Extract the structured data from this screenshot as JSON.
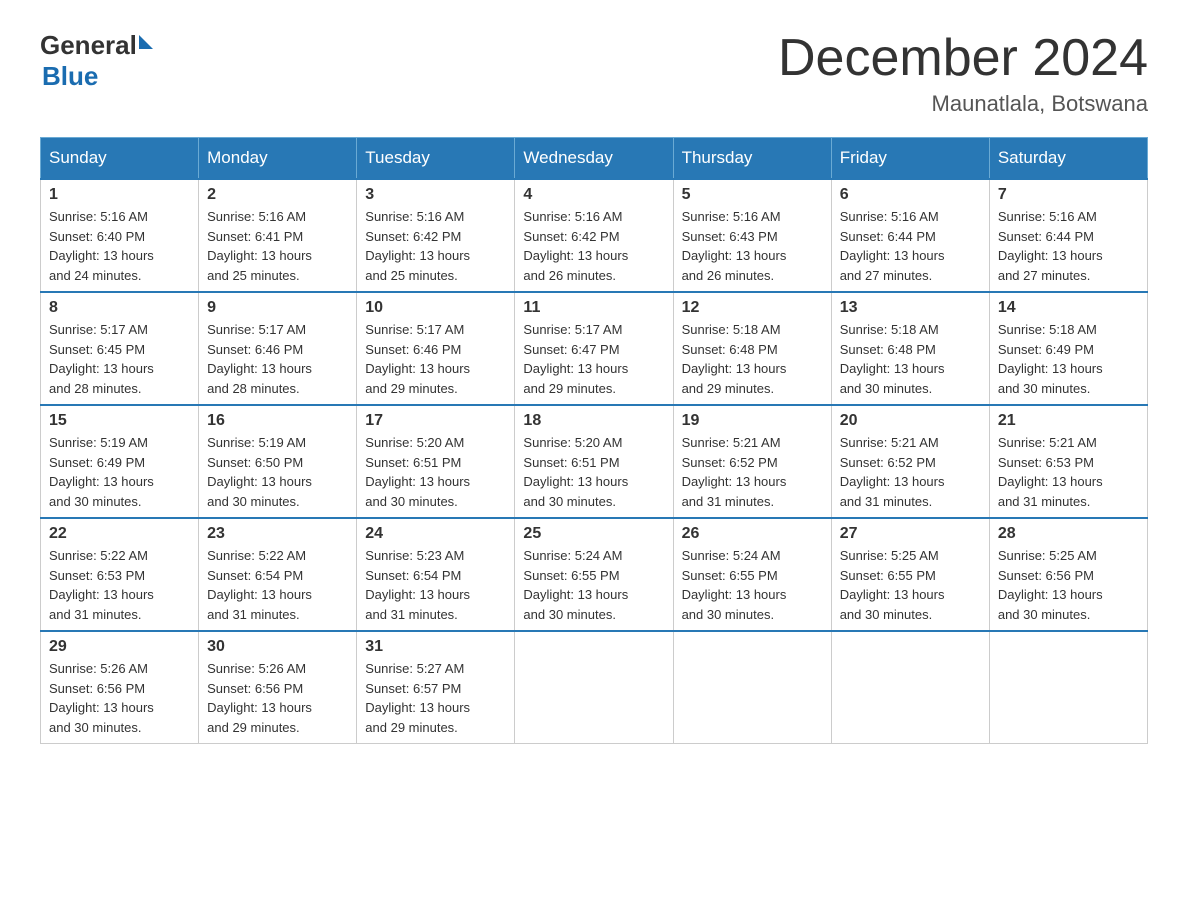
{
  "header": {
    "logo_general": "General",
    "logo_blue": "Blue",
    "month_title": "December 2024",
    "location": "Maunatlala, Botswana"
  },
  "days_of_week": [
    "Sunday",
    "Monday",
    "Tuesday",
    "Wednesday",
    "Thursday",
    "Friday",
    "Saturday"
  ],
  "weeks": [
    [
      {
        "day": "1",
        "info": "Sunrise: 5:16 AM\nSunset: 6:40 PM\nDaylight: 13 hours\nand 24 minutes."
      },
      {
        "day": "2",
        "info": "Sunrise: 5:16 AM\nSunset: 6:41 PM\nDaylight: 13 hours\nand 25 minutes."
      },
      {
        "day": "3",
        "info": "Sunrise: 5:16 AM\nSunset: 6:42 PM\nDaylight: 13 hours\nand 25 minutes."
      },
      {
        "day": "4",
        "info": "Sunrise: 5:16 AM\nSunset: 6:42 PM\nDaylight: 13 hours\nand 26 minutes."
      },
      {
        "day": "5",
        "info": "Sunrise: 5:16 AM\nSunset: 6:43 PM\nDaylight: 13 hours\nand 26 minutes."
      },
      {
        "day": "6",
        "info": "Sunrise: 5:16 AM\nSunset: 6:44 PM\nDaylight: 13 hours\nand 27 minutes."
      },
      {
        "day": "7",
        "info": "Sunrise: 5:16 AM\nSunset: 6:44 PM\nDaylight: 13 hours\nand 27 minutes."
      }
    ],
    [
      {
        "day": "8",
        "info": "Sunrise: 5:17 AM\nSunset: 6:45 PM\nDaylight: 13 hours\nand 28 minutes."
      },
      {
        "day": "9",
        "info": "Sunrise: 5:17 AM\nSunset: 6:46 PM\nDaylight: 13 hours\nand 28 minutes."
      },
      {
        "day": "10",
        "info": "Sunrise: 5:17 AM\nSunset: 6:46 PM\nDaylight: 13 hours\nand 29 minutes."
      },
      {
        "day": "11",
        "info": "Sunrise: 5:17 AM\nSunset: 6:47 PM\nDaylight: 13 hours\nand 29 minutes."
      },
      {
        "day": "12",
        "info": "Sunrise: 5:18 AM\nSunset: 6:48 PM\nDaylight: 13 hours\nand 29 minutes."
      },
      {
        "day": "13",
        "info": "Sunrise: 5:18 AM\nSunset: 6:48 PM\nDaylight: 13 hours\nand 30 minutes."
      },
      {
        "day": "14",
        "info": "Sunrise: 5:18 AM\nSunset: 6:49 PM\nDaylight: 13 hours\nand 30 minutes."
      }
    ],
    [
      {
        "day": "15",
        "info": "Sunrise: 5:19 AM\nSunset: 6:49 PM\nDaylight: 13 hours\nand 30 minutes."
      },
      {
        "day": "16",
        "info": "Sunrise: 5:19 AM\nSunset: 6:50 PM\nDaylight: 13 hours\nand 30 minutes."
      },
      {
        "day": "17",
        "info": "Sunrise: 5:20 AM\nSunset: 6:51 PM\nDaylight: 13 hours\nand 30 minutes."
      },
      {
        "day": "18",
        "info": "Sunrise: 5:20 AM\nSunset: 6:51 PM\nDaylight: 13 hours\nand 30 minutes."
      },
      {
        "day": "19",
        "info": "Sunrise: 5:21 AM\nSunset: 6:52 PM\nDaylight: 13 hours\nand 31 minutes."
      },
      {
        "day": "20",
        "info": "Sunrise: 5:21 AM\nSunset: 6:52 PM\nDaylight: 13 hours\nand 31 minutes."
      },
      {
        "day": "21",
        "info": "Sunrise: 5:21 AM\nSunset: 6:53 PM\nDaylight: 13 hours\nand 31 minutes."
      }
    ],
    [
      {
        "day": "22",
        "info": "Sunrise: 5:22 AM\nSunset: 6:53 PM\nDaylight: 13 hours\nand 31 minutes."
      },
      {
        "day": "23",
        "info": "Sunrise: 5:22 AM\nSunset: 6:54 PM\nDaylight: 13 hours\nand 31 minutes."
      },
      {
        "day": "24",
        "info": "Sunrise: 5:23 AM\nSunset: 6:54 PM\nDaylight: 13 hours\nand 31 minutes."
      },
      {
        "day": "25",
        "info": "Sunrise: 5:24 AM\nSunset: 6:55 PM\nDaylight: 13 hours\nand 30 minutes."
      },
      {
        "day": "26",
        "info": "Sunrise: 5:24 AM\nSunset: 6:55 PM\nDaylight: 13 hours\nand 30 minutes."
      },
      {
        "day": "27",
        "info": "Sunrise: 5:25 AM\nSunset: 6:55 PM\nDaylight: 13 hours\nand 30 minutes."
      },
      {
        "day": "28",
        "info": "Sunrise: 5:25 AM\nSunset: 6:56 PM\nDaylight: 13 hours\nand 30 minutes."
      }
    ],
    [
      {
        "day": "29",
        "info": "Sunrise: 5:26 AM\nSunset: 6:56 PM\nDaylight: 13 hours\nand 30 minutes."
      },
      {
        "day": "30",
        "info": "Sunrise: 5:26 AM\nSunset: 6:56 PM\nDaylight: 13 hours\nand 29 minutes."
      },
      {
        "day": "31",
        "info": "Sunrise: 5:27 AM\nSunset: 6:57 PM\nDaylight: 13 hours\nand 29 minutes."
      },
      {
        "day": "",
        "info": ""
      },
      {
        "day": "",
        "info": ""
      },
      {
        "day": "",
        "info": ""
      },
      {
        "day": "",
        "info": ""
      }
    ]
  ]
}
